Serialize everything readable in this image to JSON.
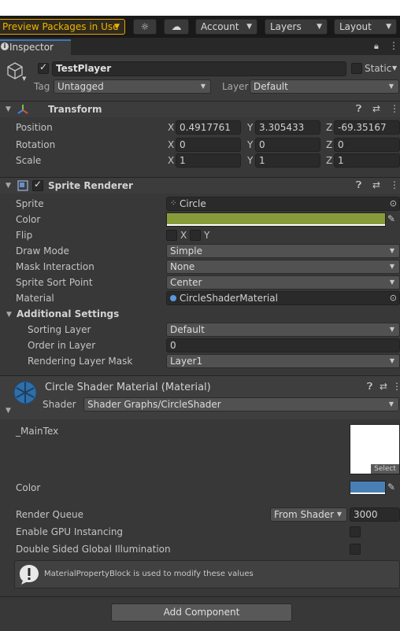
{
  "toolbar": {
    "preview_packages": "Preview Packages in Use",
    "account": "Account",
    "layers": "Layers",
    "layout": "Layout"
  },
  "tab": {
    "label": "Inspector"
  },
  "gameobject": {
    "name": "TestPlayer",
    "active": true,
    "static_label": "Static",
    "tag_label": "Tag",
    "tag_value": "Untagged",
    "layer_label": "Layer",
    "layer_value": "Default"
  },
  "transform": {
    "title": "Transform",
    "position_label": "Position",
    "rotation_label": "Rotation",
    "scale_label": "Scale",
    "axis_x": "X",
    "axis_y": "Y",
    "axis_z": "Z",
    "position": {
      "x": "0.4917761",
      "y": "3.305433",
      "z": "-69.35167"
    },
    "rotation": {
      "x": "0",
      "y": "0",
      "z": "0"
    },
    "scale": {
      "x": "1",
      "y": "1",
      "z": "1"
    }
  },
  "sprite_renderer": {
    "title": "Sprite Renderer",
    "enabled": true,
    "sprite_label": "Sprite",
    "sprite_value": "Circle",
    "color_label": "Color",
    "color_value": "#889b3a",
    "flip_label": "Flip",
    "flip_x": "X",
    "flip_y": "Y",
    "draw_mode_label": "Draw Mode",
    "draw_mode_value": "Simple",
    "mask_label": "Mask Interaction",
    "mask_value": "None",
    "sort_point_label": "Sprite Sort Point",
    "sort_point_value": "Center",
    "material_label": "Material",
    "material_value": "CircleShaderMaterial",
    "additional_settings": "Additional Settings",
    "sorting_layer_label": "Sorting Layer",
    "sorting_layer_value": "Default",
    "order_label": "Order in Layer",
    "order_value": "0",
    "rendering_mask_label": "Rendering Layer Mask",
    "rendering_mask_value": "Layer1"
  },
  "material": {
    "title": "Circle Shader Material (Material)",
    "shader_label": "Shader",
    "shader_value": "Shader Graphs/CircleShader",
    "maintex_label": "_MainTex",
    "select_label": "Select",
    "color_label": "Color",
    "color_value": "#4a7fb5",
    "render_queue_label": "Render Queue",
    "render_queue_mode": "From Shader",
    "render_queue_value": "3000",
    "gpu_instancing_label": "Enable GPU Instancing",
    "double_sided_gi_label": "Double Sided Global Illumination",
    "help_message": "MaterialPropertyBlock is used to modify these values"
  },
  "footer": {
    "add_component": "Add Component"
  }
}
